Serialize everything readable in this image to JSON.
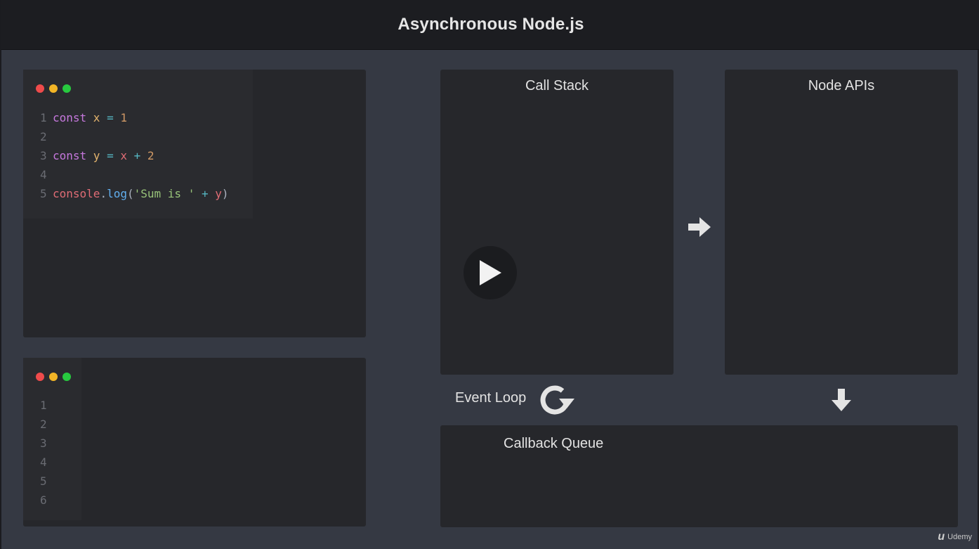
{
  "header": {
    "title": "Asynchronous Node.js"
  },
  "editor_top": {
    "lines": [
      {
        "num": "1",
        "tokens": [
          {
            "t": "const",
            "c": "kw"
          },
          {
            "t": " x",
            "c": "var"
          },
          {
            "t": " =",
            "c": "op"
          },
          {
            "t": " 1",
            "c": "num"
          }
        ]
      },
      {
        "num": "2",
        "tokens": []
      },
      {
        "num": "3",
        "tokens": [
          {
            "t": "const",
            "c": "kw"
          },
          {
            "t": " y",
            "c": "var"
          },
          {
            "t": " =",
            "c": "op"
          },
          {
            "t": " x",
            "c": "var-red"
          },
          {
            "t": " +",
            "c": "op"
          },
          {
            "t": " 2",
            "c": "num"
          }
        ]
      },
      {
        "num": "4",
        "tokens": []
      },
      {
        "num": "5",
        "tokens": [
          {
            "t": "console",
            "c": "fn"
          },
          {
            "t": ".",
            "c": "punc"
          },
          {
            "t": "log",
            "c": "method"
          },
          {
            "t": "(",
            "c": "punc"
          },
          {
            "t": "'Sum is '",
            "c": "str"
          },
          {
            "t": " +",
            "c": "op"
          },
          {
            "t": " y",
            "c": "var-red"
          },
          {
            "t": ")",
            "c": "punc"
          }
        ]
      }
    ]
  },
  "editor_bottom": {
    "line_numbers": [
      "1",
      "2",
      "3",
      "4",
      "5",
      "6"
    ]
  },
  "diagram": {
    "call_stack_label": "Call Stack",
    "node_apis_label": "Node APIs",
    "event_loop_label": "Event Loop",
    "callback_queue_label": "Callback Queue"
  },
  "player": {
    "play_icon": "play-icon"
  },
  "watermark": {
    "logo_glyph": "u",
    "text": "Udemy"
  },
  "colors": {
    "dot_red": "#ef4b4b",
    "dot_yellow": "#f2b526",
    "dot_green": "#27c93f"
  }
}
